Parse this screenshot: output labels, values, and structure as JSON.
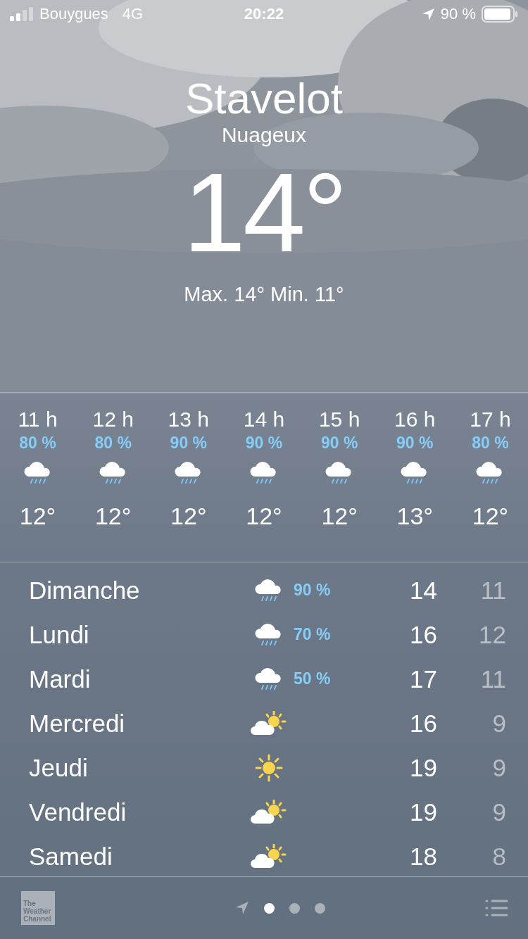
{
  "status_bar": {
    "carrier": "Bouygues",
    "network": "4G",
    "time": "20:22",
    "battery": "90 %"
  },
  "location": {
    "city": "Stavelot",
    "condition": "Nuageux",
    "temperature": "14°",
    "high_low": "Max. 14° Min. 11°"
  },
  "hourly": [
    {
      "hour": "11 h",
      "chance": "80 %",
      "kind": "rain",
      "temp": "12°"
    },
    {
      "hour": "12 h",
      "chance": "80 %",
      "kind": "rain",
      "temp": "12°"
    },
    {
      "hour": "13 h",
      "chance": "90 %",
      "kind": "rain",
      "temp": "12°"
    },
    {
      "hour": "14 h",
      "chance": "90 %",
      "kind": "rain",
      "temp": "12°"
    },
    {
      "hour": "15 h",
      "chance": "90 %",
      "kind": "rain",
      "temp": "12°"
    },
    {
      "hour": "16 h",
      "chance": "90 %",
      "kind": "rain",
      "temp": "13°"
    },
    {
      "hour": "17 h",
      "chance": "80 %",
      "kind": "rain",
      "temp": "12°"
    }
  ],
  "daily": [
    {
      "day": "Dimanche",
      "kind": "rain",
      "chance": "90 %",
      "high": "14",
      "low": "11"
    },
    {
      "day": "Lundi",
      "kind": "rain",
      "chance": "70 %",
      "high": "16",
      "low": "12"
    },
    {
      "day": "Mardi",
      "kind": "rain",
      "chance": "50 %",
      "high": "17",
      "low": "11"
    },
    {
      "day": "Mercredi",
      "kind": "partly_sunny",
      "high": "16",
      "low": "9"
    },
    {
      "day": "Jeudi",
      "kind": "sunny",
      "high": "19",
      "low": "9"
    },
    {
      "day": "Vendredi",
      "kind": "partly_sunny",
      "high": "19",
      "low": "9"
    },
    {
      "day": "Samedi",
      "kind": "partly_sunny",
      "high": "18",
      "low": "8"
    }
  ],
  "bottom_bar": {
    "logo_lines": [
      "The",
      "Weather",
      "Channel"
    ],
    "pages": [
      {
        "selected": true
      },
      {
        "selected": false
      },
      {
        "selected": false
      }
    ]
  }
}
